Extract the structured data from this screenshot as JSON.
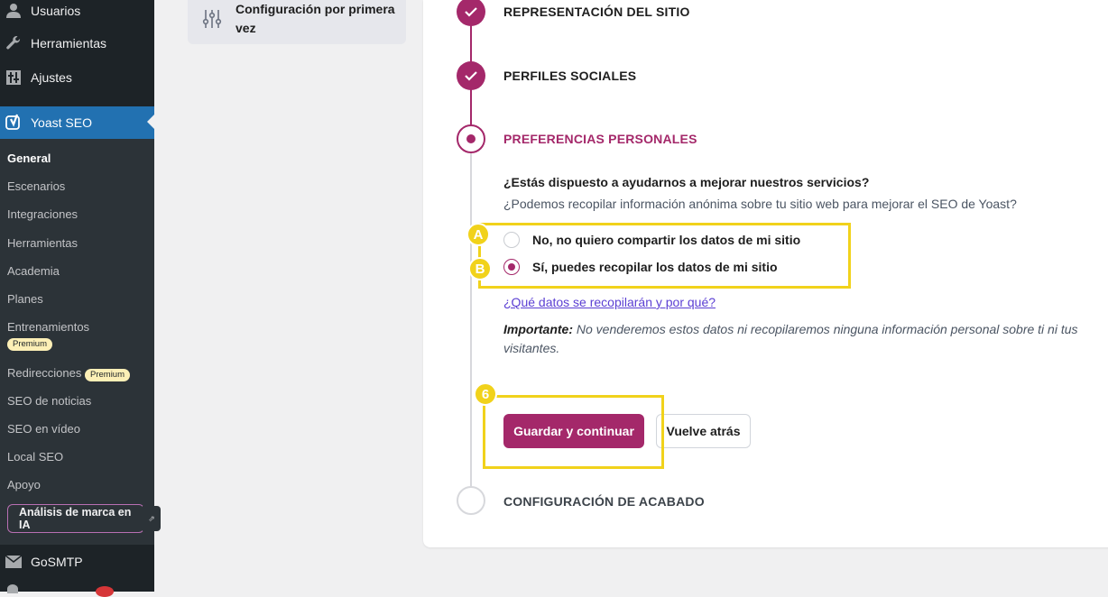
{
  "sidebar": {
    "top_items": [
      {
        "label": "Usuarios",
        "icon": "users-icon"
      },
      {
        "label": "Herramientas",
        "icon": "wrench-icon"
      },
      {
        "label": "Ajustes",
        "icon": "settings-sliders-icon"
      }
    ],
    "active_item": {
      "label": "Yoast SEO",
      "icon": "yoast-icon"
    },
    "submenu": [
      {
        "label": "General"
      },
      {
        "label": "Escenarios"
      },
      {
        "label": "Integraciones"
      },
      {
        "label": "Herramientas"
      },
      {
        "label": "Academia"
      },
      {
        "label": "Planes"
      },
      {
        "label": "Entrenamientos",
        "badge": "Premium"
      },
      {
        "label": "Redirecciones",
        "badge": "Premium"
      },
      {
        "label": "SEO de noticias"
      },
      {
        "label": "SEO en vídeo"
      },
      {
        "label": "Local SEO"
      },
      {
        "label": "Apoyo"
      }
    ],
    "ai_button": "Análisis de marca en IA",
    "bottom_item": {
      "label": "GoSMTP",
      "icon": "mail-icon"
    }
  },
  "top_card": {
    "label": "Configuración por primera vez",
    "icon": "sliders-icon"
  },
  "steps": {
    "site_representation": "REPRESENTACIÓN DEL SITIO",
    "social_profiles": "PERFILES SOCIALES",
    "personal_preferences": "PREFERENCIAS PERSONALES",
    "finish": "CONFIGURACIÓN DE ACABADO"
  },
  "preferences": {
    "question": "¿Estás dispuesto a ayudarnos a mejorar nuestros servicios?",
    "subtext": "¿Podemos recopilar información anónima sobre tu sitio web para mejorar el SEO de Yoast?",
    "option_no": "No, no quiero compartir los datos de mi sitio",
    "option_yes": "Sí, puedes recopilar los datos de mi sitio",
    "selected": "yes",
    "link": "¿Qué datos se recopilarán y por qué?",
    "important_label": "Importante:",
    "important_text": " No venderemos estos datos ni recopilaremos ninguna información personal sobre ti ni tus visitantes."
  },
  "buttons": {
    "save": "Guardar y continuar",
    "back": "Vuelve atrás"
  },
  "annotations": {
    "a": "A",
    "b": "B",
    "six": "6"
  },
  "colors": {
    "brand": "#a4286a",
    "wp_blue": "#2271b1",
    "highlight": "#f1d21b"
  }
}
